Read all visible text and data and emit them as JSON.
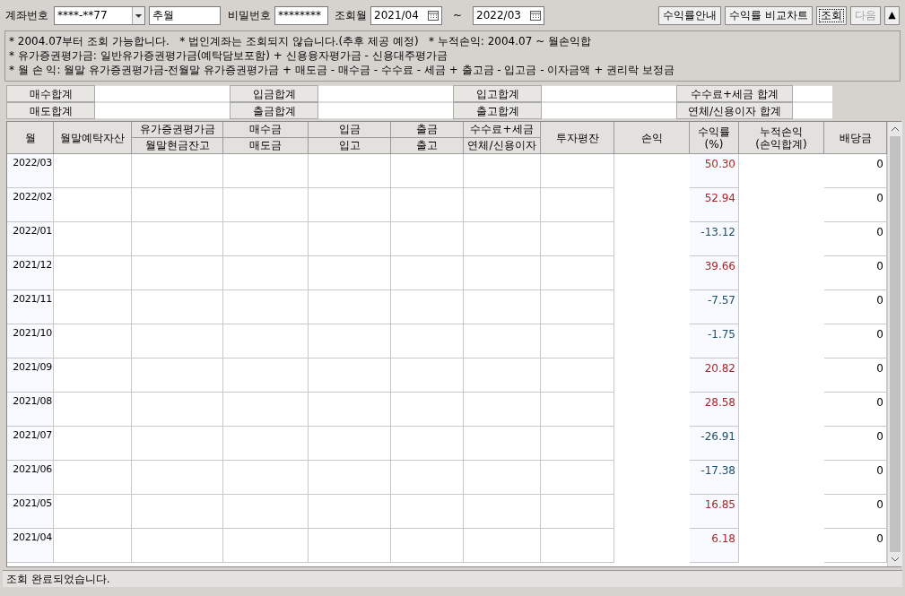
{
  "toolbar": {
    "account_label": "계좌번호",
    "account_value": "****-**77",
    "account_name": "추월",
    "password_label": "비밀번호",
    "password_value": "********",
    "period_label": "조회월",
    "period_from": "2021/04",
    "period_sep": "~",
    "period_to": "2022/03",
    "buttons": [
      {
        "label": "수익률안내",
        "disabled": false,
        "focused": false
      },
      {
        "label": "수익률 비교차트",
        "disabled": false,
        "focused": false
      },
      {
        "label": "조회",
        "disabled": false,
        "focused": true
      },
      {
        "label": "다음",
        "disabled": true,
        "focused": false
      }
    ],
    "collapse_button": "▲"
  },
  "notes": [
    "* 2004.07부터 조회 가능합니다.   * 법인계좌는 조회되지 않습니다.(추후 제공 예정)   * 누적손익: 2004.07 ~ 월손익합",
    "* 유가증권평가금: 일반유가증권평가금(예탁담보포함) + 신용융자평가금 - 신용대주평가금",
    "* 월 손 익: 월말 유가증권평가금-전월말 유가증권평가금 + 매도금 - 매수금 - 수수료 - 세금 + 출고금 - 입고금 - 이자금액 + 권리락 보정금"
  ],
  "summary": [
    [
      "매수합계",
      "입금합계",
      "입고합계",
      "수수료+세금 합계"
    ],
    [
      "매도합계",
      "출금합계",
      "출고합계",
      "연체/신용이자 합계"
    ]
  ],
  "table": {
    "columns": [
      {
        "kind": "single",
        "lines": [
          "월"
        ]
      },
      {
        "kind": "single",
        "lines": [
          "월말예탁자산"
        ]
      },
      {
        "kind": "split",
        "top": "유가증권평가금",
        "bottom": "월말현금잔고"
      },
      {
        "kind": "split",
        "top": "매수금",
        "bottom": "매도금"
      },
      {
        "kind": "split",
        "top": "입금",
        "bottom": "입고"
      },
      {
        "kind": "split",
        "top": "출금",
        "bottom": "출고"
      },
      {
        "kind": "split",
        "top": "수수료+세금",
        "bottom": "연체/신용이자"
      },
      {
        "kind": "single",
        "lines": [
          "투자평잔"
        ]
      },
      {
        "kind": "single",
        "lines": [
          "손익"
        ]
      },
      {
        "kind": "single",
        "lines": [
          "수익률",
          "(%)"
        ]
      },
      {
        "kind": "single",
        "lines": [
          "누적손익",
          "(손익합계)"
        ]
      },
      {
        "kind": "single",
        "lines": [
          "배당금"
        ]
      }
    ],
    "rows": [
      {
        "month": "2022/03",
        "rate": "50.30",
        "color": "#a52a2a",
        "dividend": "0"
      },
      {
        "month": "2022/02",
        "rate": "52.94",
        "color": "#a52a2a",
        "dividend": "0"
      },
      {
        "month": "2022/01",
        "rate": "-13.12",
        "color": "#1f4e66",
        "dividend": "0"
      },
      {
        "month": "2021/12",
        "rate": "39.66",
        "color": "#a52a2a",
        "dividend": "0"
      },
      {
        "month": "2021/11",
        "rate": "-7.57",
        "color": "#1f4e66",
        "dividend": "0"
      },
      {
        "month": "2021/10",
        "rate": "-1.75",
        "color": "#1f4e66",
        "dividend": "0"
      },
      {
        "month": "2021/09",
        "rate": "20.82",
        "color": "#a52a2a",
        "dividend": "0"
      },
      {
        "month": "2021/08",
        "rate": "28.58",
        "color": "#a52a2a",
        "dividend": "0"
      },
      {
        "month": "2021/07",
        "rate": "-26.91",
        "color": "#1f4e66",
        "dividend": "0"
      },
      {
        "month": "2021/06",
        "rate": "-17.38",
        "color": "#1f4e66",
        "dividend": "0"
      },
      {
        "month": "2021/05",
        "rate": "16.85",
        "color": "#a52a2a",
        "dividend": "0"
      },
      {
        "month": "2021/04",
        "rate": "6.18",
        "color": "#a52a2a",
        "dividend": "0"
      }
    ]
  },
  "status_bar": "조회 완료되었습니다."
}
